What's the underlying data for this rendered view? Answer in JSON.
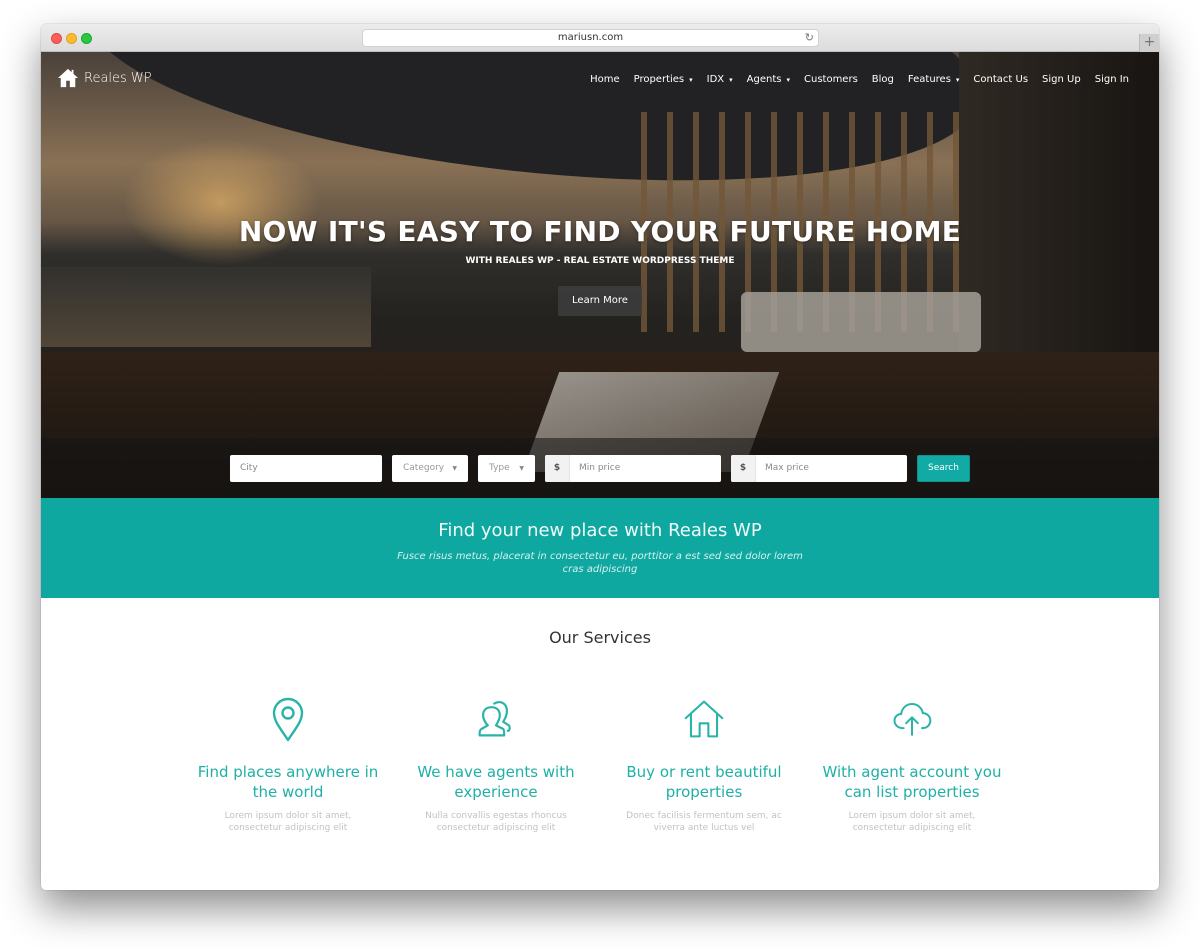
{
  "browser": {
    "url": "mariusn.com",
    "reload_icon": "reload-icon",
    "new_tab_icon": "plus-icon"
  },
  "site": {
    "logo_text": "Reales WP",
    "logo_icon": "home-icon"
  },
  "nav": {
    "items": [
      {
        "label": "Home",
        "dropdown": false
      },
      {
        "label": "Properties",
        "dropdown": true
      },
      {
        "label": "IDX",
        "dropdown": true
      },
      {
        "label": "Agents",
        "dropdown": true
      },
      {
        "label": "Customers",
        "dropdown": false
      },
      {
        "label": "Blog",
        "dropdown": false
      },
      {
        "label": "Features",
        "dropdown": true
      },
      {
        "label": "Contact Us",
        "dropdown": false
      },
      {
        "label": "Sign Up",
        "dropdown": false
      },
      {
        "label": "Sign In",
        "dropdown": false
      }
    ],
    "chevron": "⌄"
  },
  "hero": {
    "title": "NOW IT'S EASY TO FIND YOUR FUTURE HOME",
    "subtitle": "WITH REALES WP - REAL ESTATE WORDPRESS THEME",
    "button_label": "Learn More"
  },
  "search": {
    "city_placeholder": "City",
    "category_label": "Category",
    "type_label": "Type",
    "currency_symbol": "$",
    "min_price_placeholder": "Min price",
    "max_price_placeholder": "Max price",
    "button_label": "Search",
    "caret": "▼"
  },
  "banner": {
    "title": "Find your new place with Reales WP",
    "text": "Fusce risus metus, placerat in consectetur eu, porttitor a est sed sed dolor lorem cras adipiscing"
  },
  "services": {
    "title": "Our Services",
    "items": [
      {
        "icon": "map-pin-icon",
        "title": "Find places anywhere in the world",
        "text": "Lorem ipsum dolor sit amet, consectetur adipiscing elit"
      },
      {
        "icon": "users-icon",
        "title": "We have agents with experience",
        "text": "Nulla convallis egestas rhoncus consectetur adipiscing elit"
      },
      {
        "icon": "house-icon",
        "title": "Buy or rent beautiful properties",
        "text": "Donec facilisis fermentum sem, ac viverra ante luctus vel"
      },
      {
        "icon": "cloud-upload-icon",
        "title": "With agent account you can list properties",
        "text": "Lorem ipsum dolor sit amet, consectetur adipiscing elit"
      }
    ]
  },
  "colors": {
    "accent": "#0ea8a1",
    "service_title": "#1fb0a6",
    "search_button": "#12aaa4"
  }
}
